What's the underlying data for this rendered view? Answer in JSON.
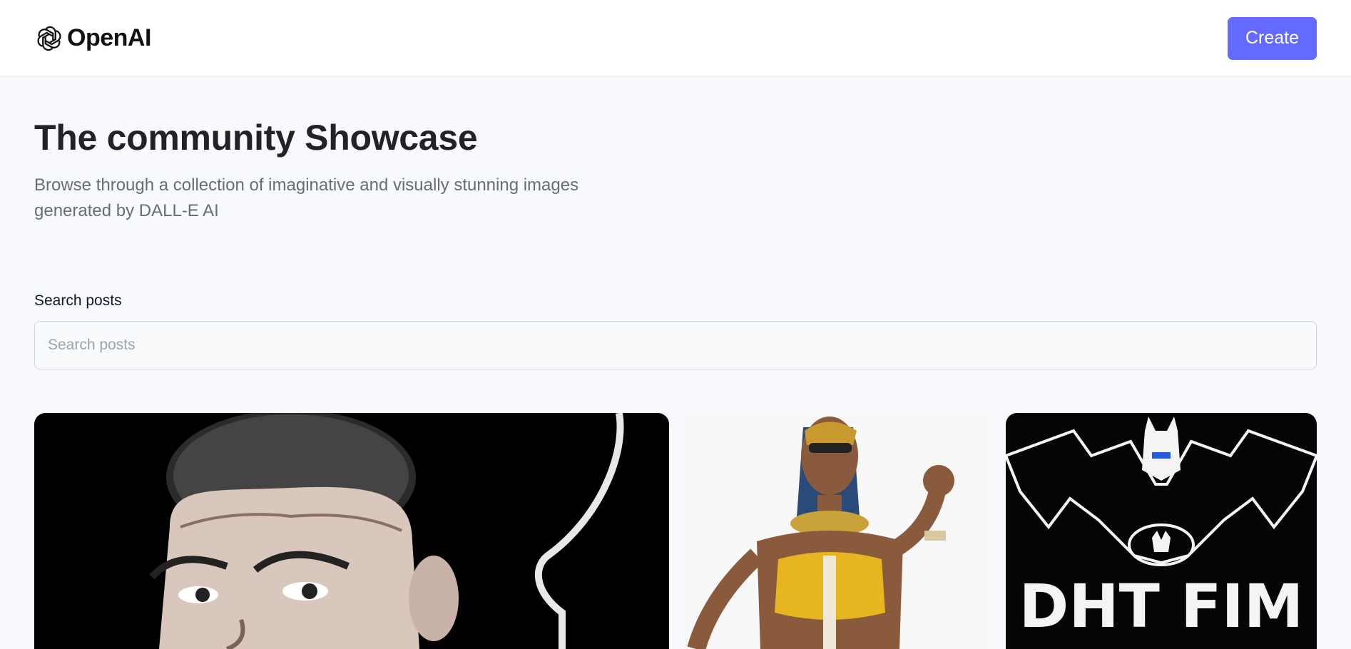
{
  "header": {
    "brand": "OpenAI",
    "create_label": "Create"
  },
  "hero": {
    "title": "The community Showcase",
    "subtitle": "Browse through a collection of imaginative and visually stunning images generated by DALL-E AI"
  },
  "search": {
    "label": "Search posts",
    "placeholder": "Search posts",
    "value": ""
  },
  "cards": [
    {
      "name": "portrait-card",
      "icon": "portrait-image"
    },
    {
      "name": "egyptian-figure-card",
      "icon": "figure-image"
    },
    {
      "name": "bat-emblem-card",
      "icon": "bat-image",
      "image_text": "DHT FIM"
    }
  ],
  "colors": {
    "accent": "#6469ff",
    "background": "#f8f9fc",
    "title": "#222328",
    "subtitle": "#666e75"
  }
}
